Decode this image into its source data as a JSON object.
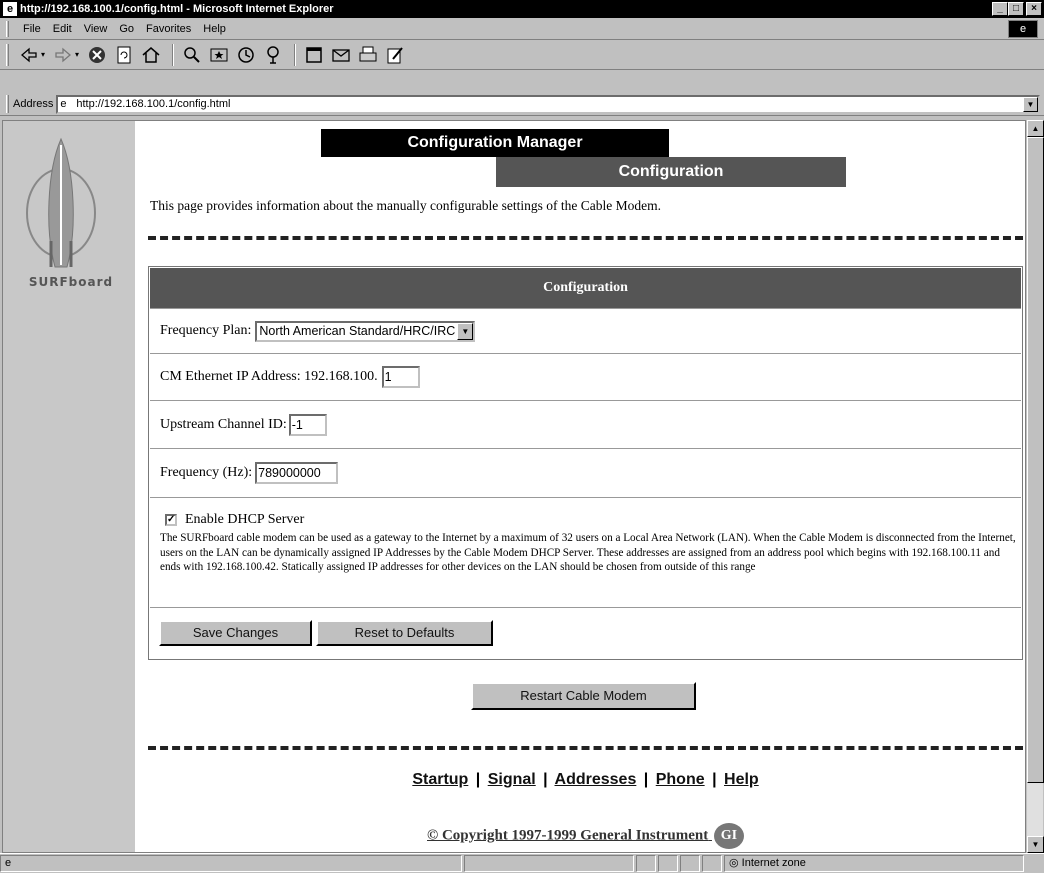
{
  "window": {
    "title": "http://192.168.100.1/config.html - Microsoft Internet Explorer",
    "min_glyph": "_",
    "max_glyph": "□",
    "close_glyph": "×"
  },
  "menu": [
    "File",
    "Edit",
    "View",
    "Go",
    "Favorites",
    "Help"
  ],
  "address": {
    "label": "Address",
    "url": "http://192.168.100.1/config.html"
  },
  "status": {
    "zone": "Internet zone"
  },
  "sidebar": {
    "brand": "SURFboard"
  },
  "header": {
    "app_title": "Configuration Manager",
    "section_title": "Configuration"
  },
  "intro": "This page provides information about the manually configurable settings of the Cable Modem.",
  "config": {
    "table_title": "Configuration",
    "frequency_plan_label": "Frequency Plan:",
    "frequency_plan_value": "North American Standard/HRC/IRC",
    "cm_ip_label": "CM Ethernet IP Address: 192.168.100.",
    "cm_ip_value": "1",
    "upstream_label": "Upstream Channel ID:",
    "upstream_value": "-1",
    "frequency_label": "Frequency (Hz):",
    "frequency_value": "789000000",
    "dhcp_label": "Enable DHCP Server",
    "dhcp_checked": true,
    "dhcp_description": "The SURFboard cable modem can be used as a gateway to the Internet by a maximum of 32 users on a Local Area Network (LAN). When the Cable Modem is disconnected from the Internet, users on the LAN can be dynamically assigned IP Addresses by the Cable Modem DHCP Server. These addresses are assigned from an address pool which begins with 192.168.100.11 and ends with 192.168.100.42. Statically assigned IP addresses for other devices on the LAN should be chosen from outside of this range",
    "save_label": "Save Changes",
    "reset_label": "Reset to Defaults"
  },
  "restart_label": "Restart Cable Modem",
  "footer": {
    "links": [
      "Startup",
      "Signal",
      "Addresses",
      "Phone",
      "Help"
    ],
    "separator": "|",
    "copyright": "© Copyright 1997-1999 General Instrument",
    "gi_logo": "GI"
  },
  "icons": {
    "back": "back-arrow-icon",
    "forward": "forward-arrow-icon",
    "stop": "stop-icon",
    "refresh": "refresh-icon",
    "home": "home-icon",
    "search": "search-icon",
    "favorites": "favorites-icon",
    "history": "history-icon",
    "channels": "channels-icon",
    "fullscreen": "fullscreen-icon",
    "mail": "mail-icon",
    "print": "print-icon",
    "edit": "edit-icon"
  }
}
